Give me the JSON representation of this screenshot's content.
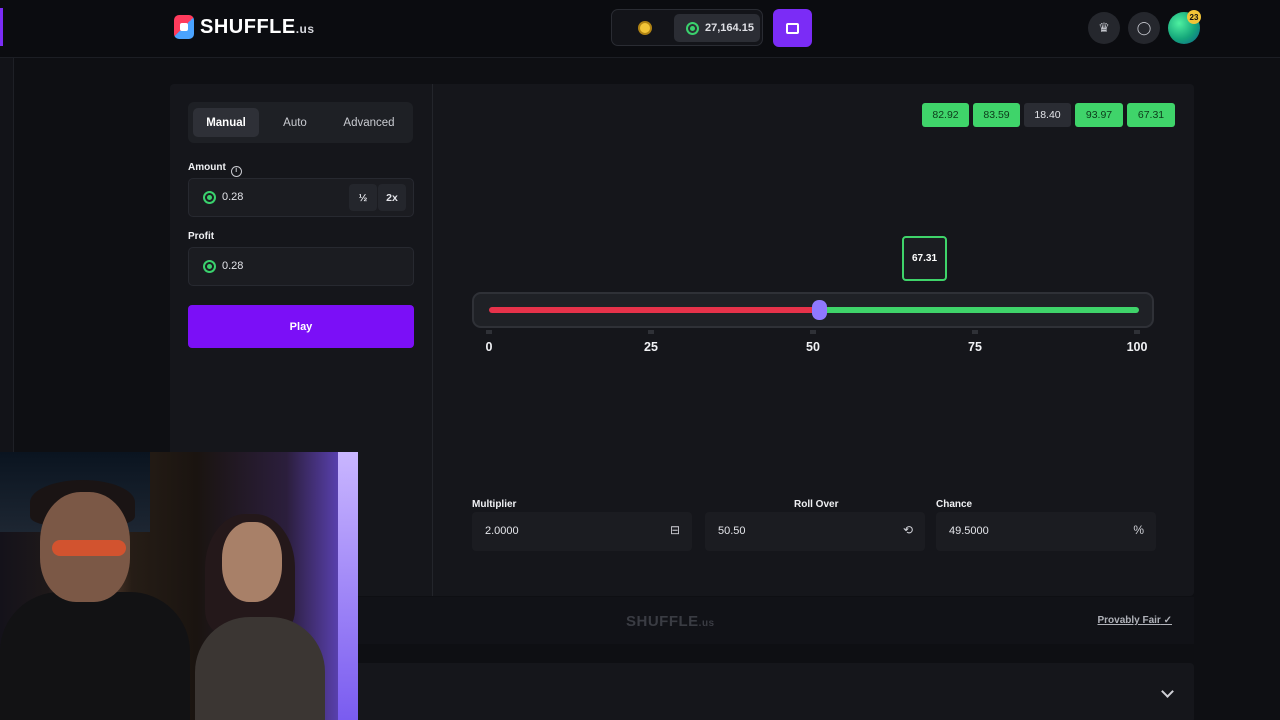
{
  "brand": {
    "name": "SHUFFLE",
    "tld": ".us"
  },
  "header": {
    "balance": "27,164.15",
    "notification_count": "23"
  },
  "controls": {
    "tabs": [
      "Manual",
      "Auto",
      "Advanced"
    ],
    "amount_label": "Amount",
    "amount_value": "0.28",
    "half_label": "½",
    "double_label": "2x",
    "profit_label": "Profit",
    "profit_value": "0.28",
    "play_label": "Play"
  },
  "history": [
    {
      "value": "82.92",
      "result": "win"
    },
    {
      "value": "83.59",
      "result": "win"
    },
    {
      "value": "18.40",
      "result": "lose"
    },
    {
      "value": "93.97",
      "result": "win"
    },
    {
      "value": "67.31",
      "result": "win"
    }
  ],
  "slider": {
    "result": "67.31",
    "roll_over": 50.5,
    "ticks": [
      "0",
      "25",
      "50",
      "75",
      "100"
    ],
    "colors": {
      "lose": "#e7324a",
      "win": "#3fd46a",
      "handle": "#8f78ff"
    }
  },
  "stats": {
    "multiplier_label": "Multiplier",
    "multiplier_value": "2.0000",
    "rollover_label": "Roll Over",
    "rollover_value": "50.50",
    "chance_label": "Chance",
    "chance_value": "49.5000",
    "chance_suffix": "%"
  },
  "footer": {
    "provably_fair": "Provably Fair"
  },
  "colors": {
    "accent": "#7b0ff7",
    "background": "#0e0f13",
    "panel": "#15161b"
  }
}
